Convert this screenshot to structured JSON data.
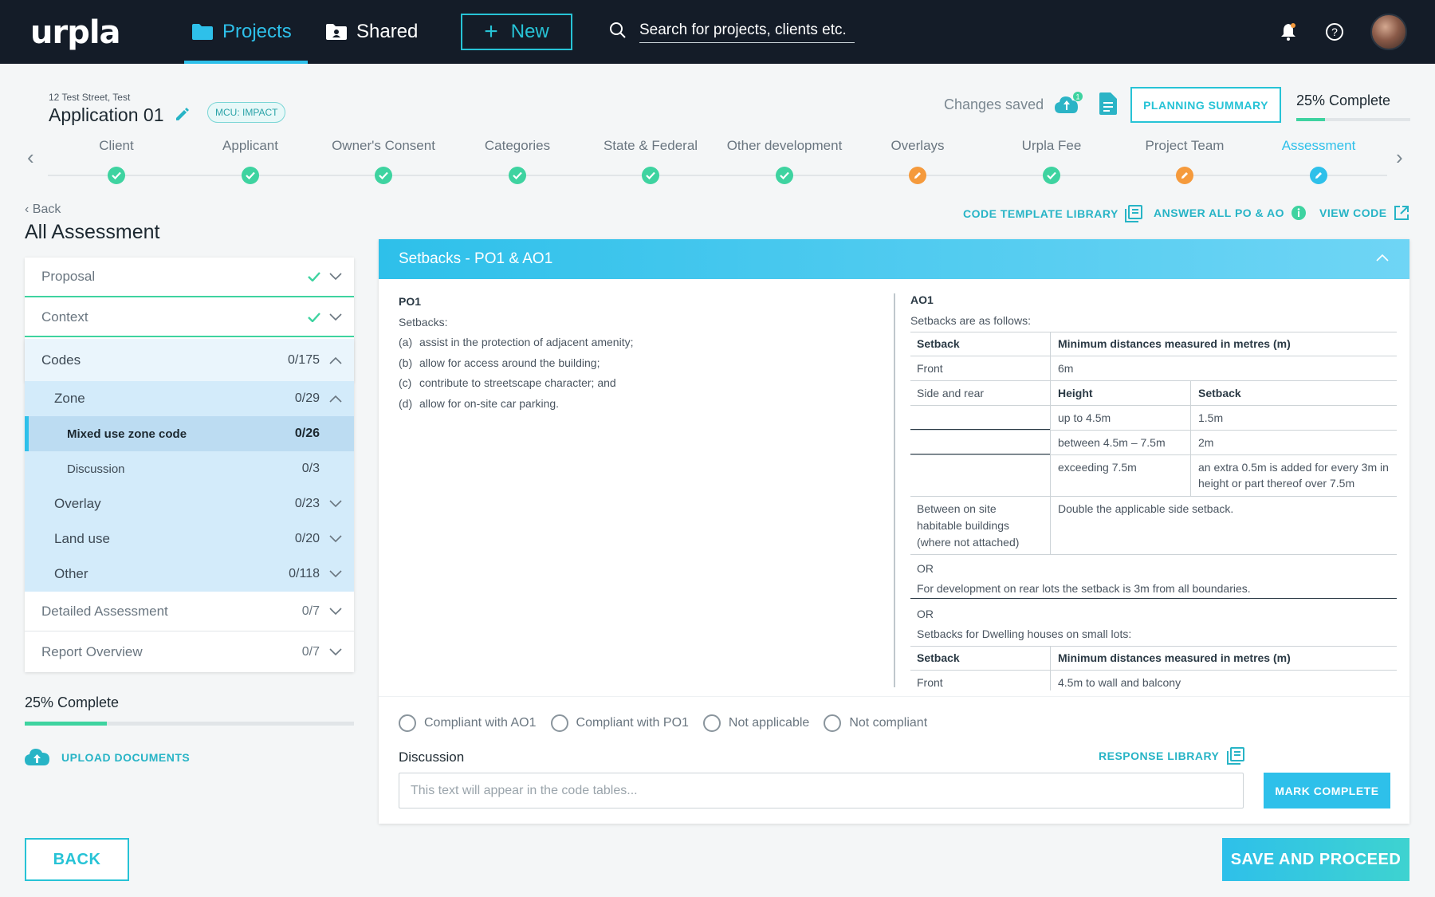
{
  "nav": {
    "logo": "urpla",
    "projects_label": "Projects",
    "shared_label": "Shared",
    "new_label": "New",
    "search_placeholder": "Search for projects, clients etc."
  },
  "header": {
    "address": "12 Test Street, Test",
    "title": "Application 01",
    "badge": "MCU: IMPACT",
    "changes_saved": "Changes saved",
    "upload_count": "1",
    "planning_summary": "PLANNING SUMMARY",
    "percent_complete": "25% Complete",
    "progress": 0.25
  },
  "steps": [
    {
      "label": "Client",
      "status": "done"
    },
    {
      "label": "Applicant",
      "status": "done"
    },
    {
      "label": "Owner's Consent",
      "status": "done"
    },
    {
      "label": "Categories",
      "status": "done"
    },
    {
      "label": "State & Federal",
      "status": "done"
    },
    {
      "label": "Other development",
      "status": "done"
    },
    {
      "label": "Overlays",
      "status": "edit"
    },
    {
      "label": "Urpla Fee",
      "status": "done"
    },
    {
      "label": "Project Team",
      "status": "edit"
    },
    {
      "label": "Assessment",
      "status": "active"
    }
  ],
  "left": {
    "back": "Back",
    "heading": "All Assessment",
    "menu": {
      "proposal": "Proposal",
      "context": "Context",
      "codes": "Codes",
      "codes_count": "0/175",
      "zone": "Zone",
      "zone_count": "0/29",
      "mixed_use": "Mixed use zone code",
      "mixed_use_count": "0/26",
      "discussion": "Discussion",
      "discussion_count": "0/3",
      "overlay": "Overlay",
      "overlay_count": "0/23",
      "land_use": "Land use",
      "land_use_count": "0/20",
      "other": "Other",
      "other_count": "0/118",
      "detailed": "Detailed Assessment",
      "detailed_count": "0/7",
      "report": "Report Overview",
      "report_count": "0/7"
    },
    "percent_complete": "25% Complete",
    "progress": 0.25,
    "upload": "UPLOAD DOCUMENTS",
    "back_button": "BACK"
  },
  "actions": {
    "code_template": "CODE TEMPLATE LIBRARY",
    "answer_all": "ANSWER ALL PO & AO",
    "view_code": "VIEW CODE"
  },
  "card": {
    "title": "Setbacks - PO1 & AO1",
    "po": {
      "heading": "PO1",
      "intro": "Setbacks:",
      "items": [
        {
          "label": "(a)",
          "text": "assist in the protection of adjacent amenity;"
        },
        {
          "label": "(b)",
          "text": "allow for access around the building;"
        },
        {
          "label": "(c)",
          "text": "contribute to streetscape character; and"
        },
        {
          "label": "(d)",
          "text": "allow for on-site car parking."
        }
      ]
    },
    "ao": {
      "heading": "AO1",
      "intro": "Setbacks are as follows:",
      "col_setback": "Setback",
      "col_min": "Minimum distances measured in metres (m)",
      "front": "Front",
      "front_val": "6m",
      "side_rear": "Side and rear",
      "height": "Height",
      "setback": "Setback",
      "h1": "up to 4.5m",
      "s1": "1.5m",
      "h2": "between 4.5m – 7.5m",
      "s2": "2m",
      "h3": "exceeding 7.5m",
      "s3": "an extra 0.5m is added for every 3m in height or part thereof over 7.5m",
      "between_label": "Between on site habitable buildings (where not attached)",
      "between_val": "Double the applicable side setback.",
      "or1": "OR",
      "rear_lots": "For development on rear lots the setback is 3m from all boundaries.",
      "or2": "OR",
      "small_lots": "Setbacks for Dwelling houses on small lots:",
      "col_setback2": "Setback",
      "col_min2": "Minimum distances measured in metres (m)",
      "front2": "Front",
      "front2_val": "4.5m to wall and balcony"
    },
    "options": [
      "Compliant with AO1",
      "Compliant with PO1",
      "Not applicable",
      "Not compliant"
    ],
    "discussion_label": "Discussion",
    "response_library": "RESPONSE LIBRARY",
    "discussion_placeholder": "This text will appear in the code tables...",
    "mark_complete": "MARK COMPLETE"
  },
  "footer": {
    "save": "SAVE AND PROCEED"
  },
  "colors": {
    "accent": "#2ec0ea",
    "teal": "#27c3d6",
    "success": "#3ed3a0",
    "warning": "#f59a3c",
    "nav_bg": "#141c28"
  }
}
